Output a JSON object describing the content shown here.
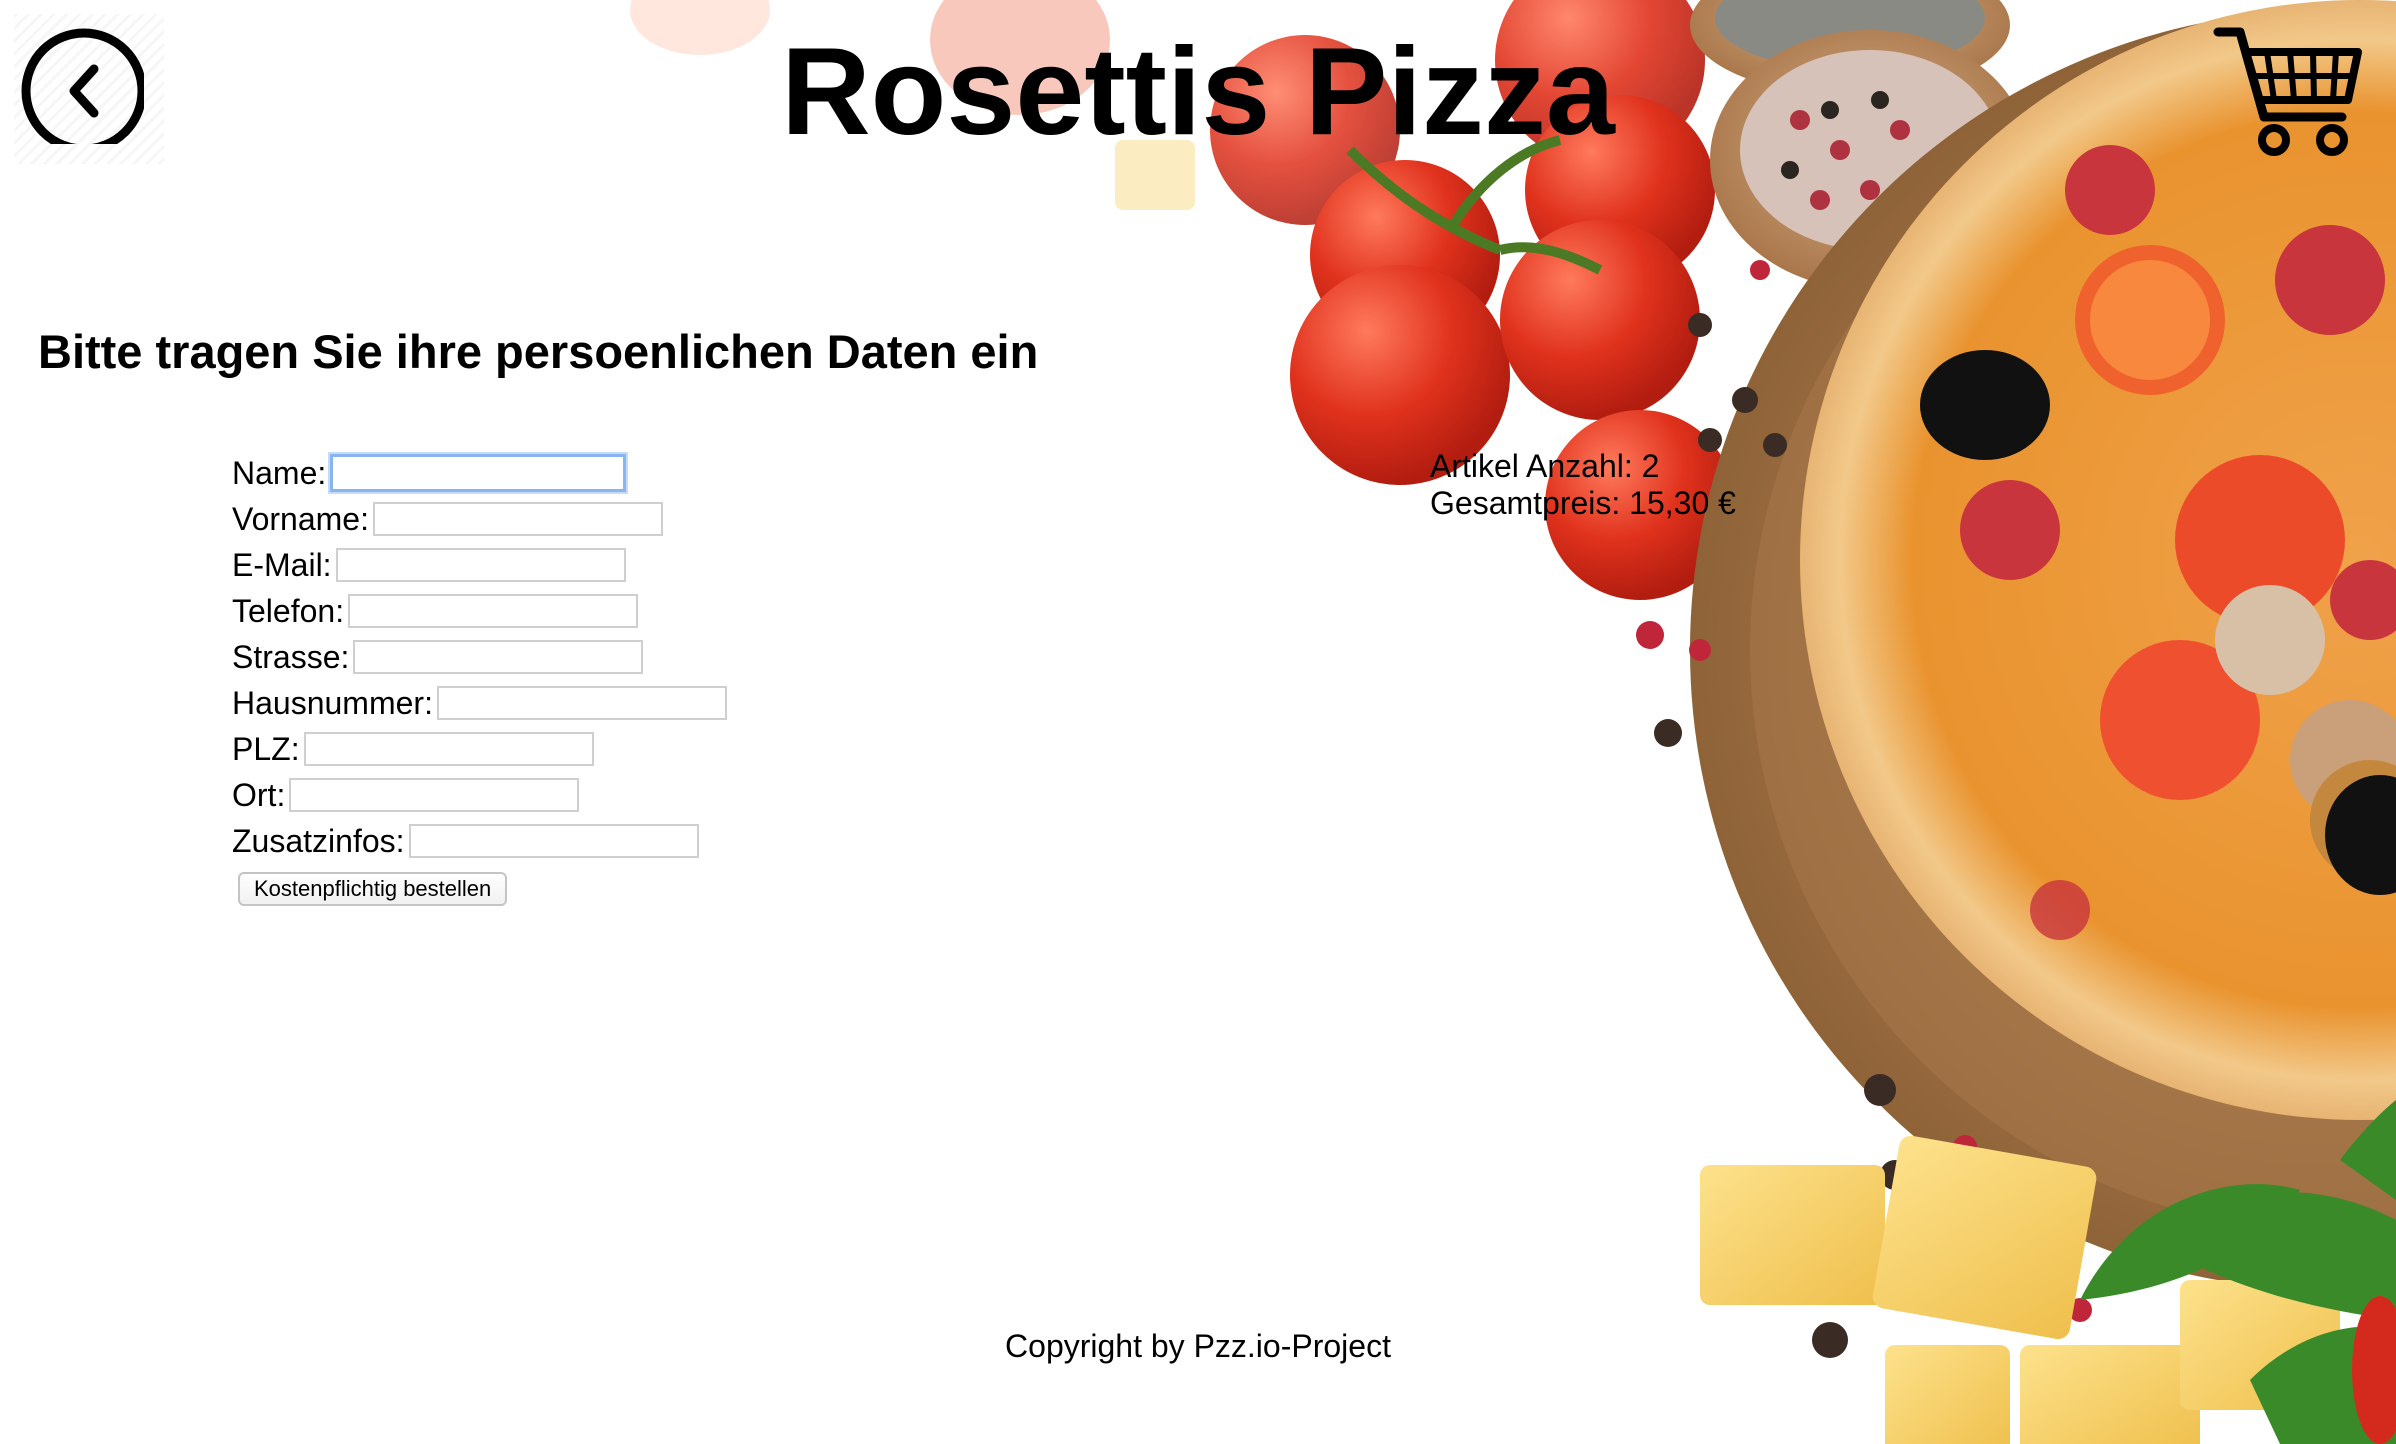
{
  "header": {
    "title": "Rosettis Pizza",
    "back_icon": "chevron-left-icon",
    "cart_icon": "shopping-cart-icon"
  },
  "form": {
    "heading": "Bitte tragen Sie ihre persoenlichen Daten ein",
    "fields": [
      {
        "label": "Name:",
        "value": "",
        "placeholder": "",
        "focused": true
      },
      {
        "label": "Vorname:",
        "value": "",
        "placeholder": ""
      },
      {
        "label": "E-Mail:",
        "value": "",
        "placeholder": ""
      },
      {
        "label": "Telefon:",
        "value": "",
        "placeholder": ""
      },
      {
        "label": "Strasse:",
        "value": "",
        "placeholder": ""
      },
      {
        "label": "Hausnummer:",
        "value": "",
        "placeholder": ""
      },
      {
        "label": "PLZ:",
        "value": "",
        "placeholder": ""
      },
      {
        "label": "Ort:",
        "value": "",
        "placeholder": ""
      },
      {
        "label": "Zusatzinfos:",
        "value": "",
        "placeholder": ""
      }
    ],
    "submit_label": "Kostenpflichtig bestellen"
  },
  "cart_summary": {
    "item_count": "Artikel Anzahl: 2",
    "total_price": "Gesamtpreis: 15,30 €"
  },
  "footer": {
    "copyright": "Copyright by Pzz.io-Project"
  },
  "colors": {
    "background": "#ffffff",
    "text": "#000000",
    "focus_ring": "#8ab4f0",
    "tomato": "#e23a22",
    "pizza_crust": "#e9b56a",
    "board_wood": "#b88a5a",
    "cheese": "#f6d36a",
    "parsley": "#3f8f2b"
  }
}
